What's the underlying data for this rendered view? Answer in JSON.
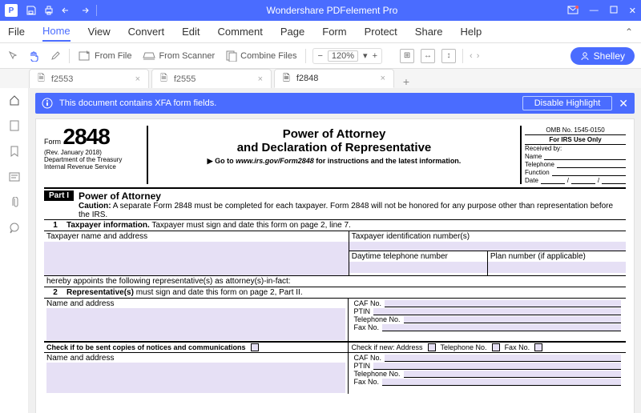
{
  "app": {
    "title": "Wondershare PDFelement Pro"
  },
  "titlebar_icons": {
    "save": "save-icon",
    "print": "print-icon",
    "undo": "undo-icon",
    "redo": "redo-icon"
  },
  "menu": {
    "file": "File",
    "home": "Home",
    "view": "View",
    "convert": "Convert",
    "edit": "Edit",
    "comment": "Comment",
    "page": "Page",
    "form": "Form",
    "protect": "Protect",
    "share": "Share",
    "help": "Help"
  },
  "toolbar": {
    "from_file": "From File",
    "from_scanner": "From Scanner",
    "combine_files": "Combine Files",
    "zoom": "120%",
    "user": "Shelley"
  },
  "tabs": [
    {
      "label": "f2553",
      "active": false
    },
    {
      "label": "f2555",
      "active": false
    },
    {
      "label": "f2848",
      "active": true
    }
  ],
  "infobar": {
    "message": "This document contains XFA form fields.",
    "button": "Disable Highlight"
  },
  "form": {
    "form_label": "Form",
    "number": "2848",
    "rev": "(Rev. January 2018)",
    "dept1": "Department of the Treasury",
    "dept2": "Internal Revenue Service",
    "title1": "Power of Attorney",
    "title2": "and Declaration of Representative",
    "goto_prefix": "▶ Go to ",
    "goto_url": "www.irs.gov/Form2848",
    "goto_suffix": " for instructions and the latest information.",
    "omb": "OMB No. 1545-0150",
    "irs_only": "For IRS Use Only",
    "received_by": "Received by:",
    "name": "Name",
    "telephone": "Telephone",
    "function": "Function",
    "date": "Date",
    "date_sep": "/",
    "part": "Part I",
    "part_heading": "Power of Attorney",
    "caution_label": "Caution:",
    "caution_text": " A separate Form 2848 must be completed for each taxpayer. Form 2848 will not be honored for any purpose other than representation before the IRS.",
    "row1_num": "1",
    "row1_bold": "Taxpayer information.",
    "row1_rest": " Taxpayer must sign and date this form on page 2, line 7.",
    "cell_taxpayer": "Taxpayer name and address",
    "cell_tin": "Taxpayer identification number(s)",
    "cell_daytel": "Daytime telephone number",
    "cell_plan": "Plan number (if applicable)",
    "appoints": "hereby appoints the following representative(s) as attorney(s)-in-fact:",
    "row2_num": "2",
    "row2_bold": "Representative(s)",
    "row2_rest": " must sign and date this form on page 2, Part II.",
    "name_addr": "Name and address",
    "caf": "CAF No.",
    "ptin": "PTIN",
    "telno": "Telephone No.",
    "faxno": "Fax No.",
    "check_copies": "Check if to be sent copies of notices and communications",
    "check_if_new": "Check if new: Address",
    "telno_short": "Telephone No.",
    "faxno_short": "Fax No."
  }
}
